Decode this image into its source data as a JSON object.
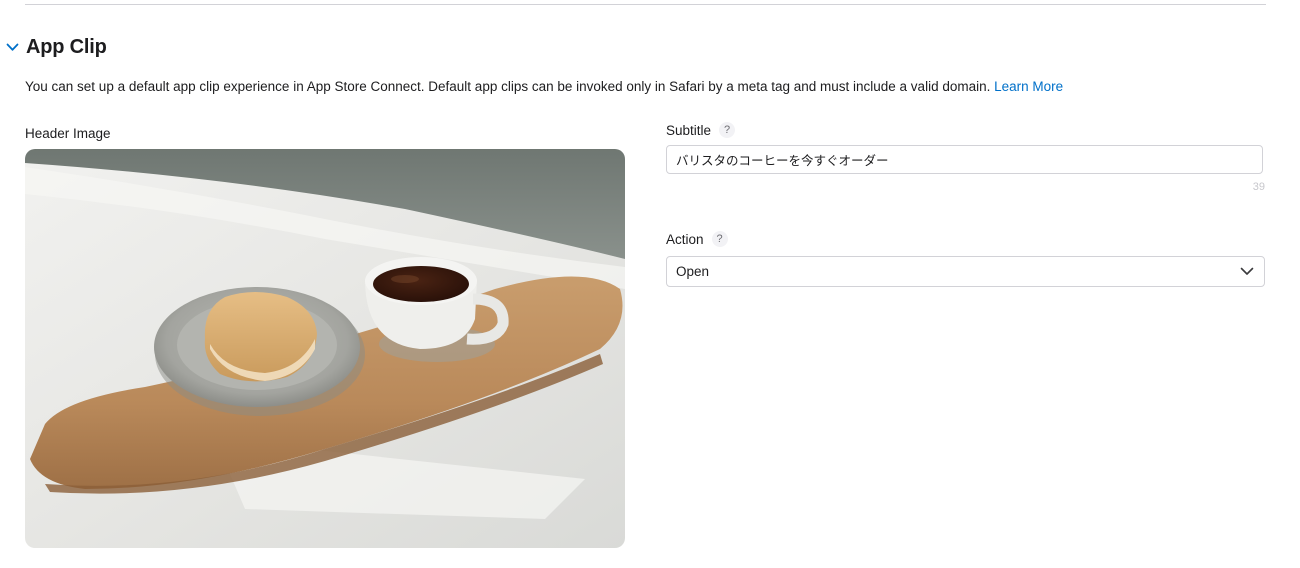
{
  "section": {
    "title": "App Clip",
    "collapse_icon": "chevron-down-icon",
    "description": "You can set up a default app clip experience in App Store Connect. Default app clips can be invoked only in Safari by a meta tag and must include a valid domain.",
    "learn_more_label": "Learn More"
  },
  "header_image": {
    "label": "Header Image"
  },
  "subtitle": {
    "label": "Subtitle",
    "help_glyph": "?",
    "value": "バリスタのコーヒーを今すぐオーダー",
    "char_count": "39"
  },
  "action": {
    "label": "Action",
    "help_glyph": "?",
    "selected": "Open",
    "dropdown_icon": "chevron-down-icon"
  },
  "colors": {
    "link": "#0070c9",
    "border": "#d2d2d7",
    "text": "#1d1d1f"
  }
}
